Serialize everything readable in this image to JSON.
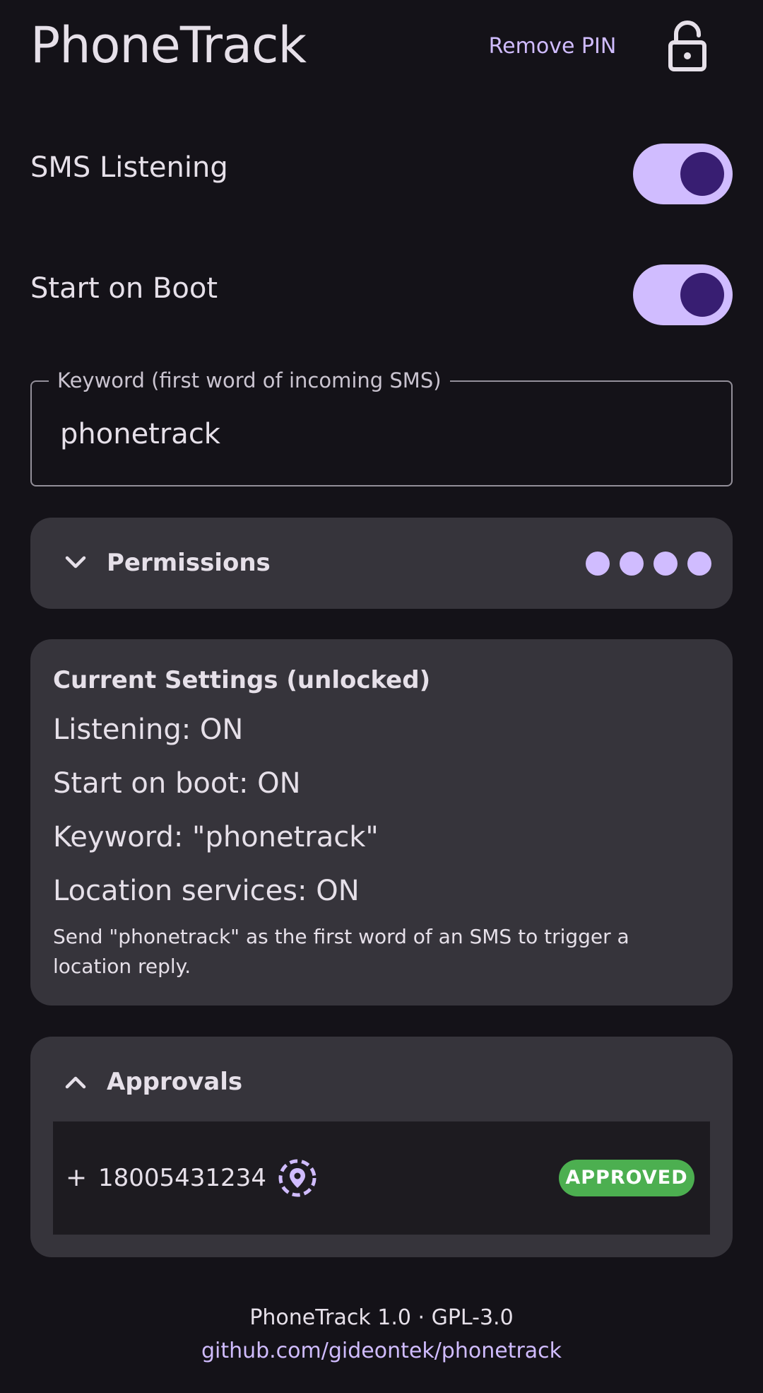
{
  "header": {
    "title": "PhoneTrack",
    "remove_pin_label": "Remove PIN",
    "lock_icon": "lock-open-icon"
  },
  "toggles": {
    "sms_listening": {
      "label": "SMS Listening",
      "checked": true
    },
    "start_on_boot": {
      "label": "Start on Boot",
      "checked": true
    }
  },
  "keyword_field": {
    "label": "Keyword (first word of incoming SMS)",
    "value": "phonetrack"
  },
  "permissions": {
    "heading": "Permissions",
    "expanded": false,
    "indicator_count": 4
  },
  "current_settings": {
    "title": "Current Settings (unlocked)",
    "lines": [
      "Listening: ON",
      "Start on boot: ON",
      "Keyword: \"phonetrack\"",
      "Location services: ON"
    ],
    "hint": "Send \"phonetrack\" as the first word of an SMS to trigger a location reply."
  },
  "approvals": {
    "heading": "Approvals",
    "expanded": true,
    "items": [
      {
        "prefix": "+",
        "phone": "18005431234",
        "icon": "location-pin-icon",
        "status": "APPROVED"
      }
    ]
  },
  "footer": {
    "version": "PhoneTrack 1.0 · GPL-3.0",
    "link": "github.com/gideontek/phonetrack"
  },
  "colors": {
    "background": "#141218",
    "surface": "#36343B",
    "primary": "#D0BCFF",
    "on_primary": "#381E72",
    "approved": "#4CAF50"
  }
}
